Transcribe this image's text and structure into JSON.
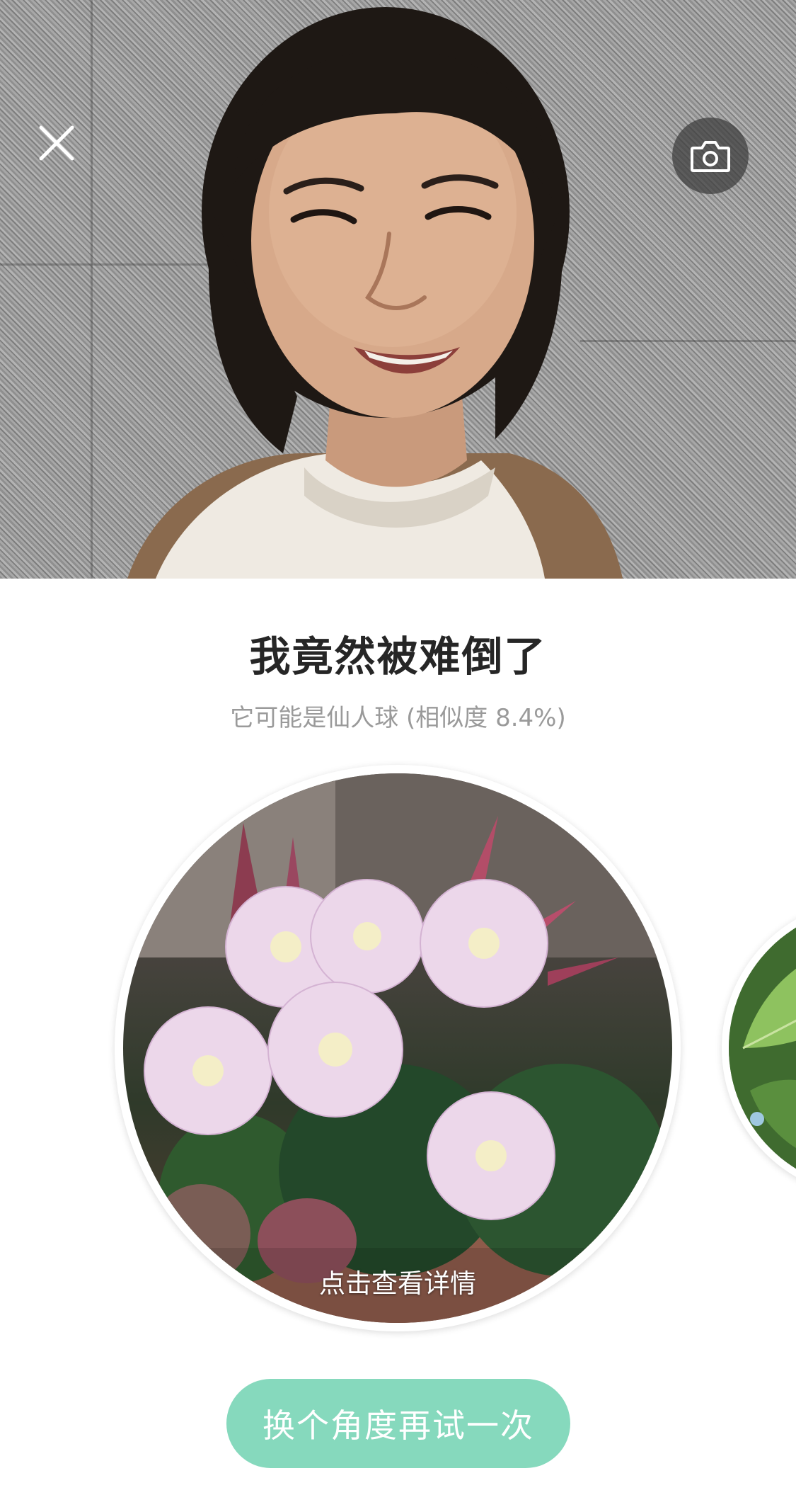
{
  "header": {
    "close_icon": "close-icon",
    "camera_icon": "camera-icon"
  },
  "result": {
    "title": "我竟然被难倒了",
    "subtitle": "它可能是仙人球 (相似度 8.4%)"
  },
  "carousel": {
    "items": [
      {
        "caption": "点击查看详情",
        "subject": "cactus-flowers"
      },
      {
        "caption": "",
        "subject": "green-leaves"
      }
    ]
  },
  "actions": {
    "retry_label": "换个角度再试一次"
  },
  "colors": {
    "accent": "#86d9bd",
    "title": "#262626",
    "subtitle": "#9a9a9a"
  }
}
